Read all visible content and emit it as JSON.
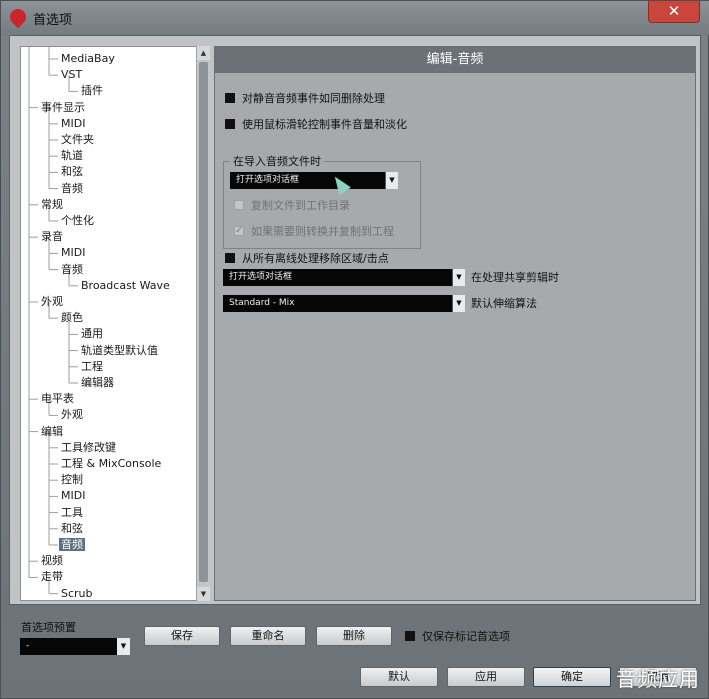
{
  "window": {
    "title": "首选项",
    "close_glyph": "✕"
  },
  "tree": {
    "items": [
      {
        "label": "MediaBay",
        "level": 1
      },
      {
        "label": "VST",
        "level": 1
      },
      {
        "label": "插件",
        "level": 2
      },
      {
        "label": "事件显示",
        "level": 0
      },
      {
        "label": "MIDI",
        "level": 1
      },
      {
        "label": "文件夹",
        "level": 1
      },
      {
        "label": "轨道",
        "level": 1
      },
      {
        "label": "和弦",
        "level": 1
      },
      {
        "label": "音频",
        "level": 1
      },
      {
        "label": "常规",
        "level": 0
      },
      {
        "label": "个性化",
        "level": 1
      },
      {
        "label": "录音",
        "level": 0
      },
      {
        "label": "MIDI",
        "level": 1
      },
      {
        "label": "音频",
        "level": 1
      },
      {
        "label": "Broadcast Wave",
        "level": 2
      },
      {
        "label": "外观",
        "level": 0
      },
      {
        "label": "颜色",
        "level": 1
      },
      {
        "label": "通用",
        "level": 2
      },
      {
        "label": "轨道类型默认值",
        "level": 2
      },
      {
        "label": "工程",
        "level": 2
      },
      {
        "label": "编辑器",
        "level": 2
      },
      {
        "label": "电平表",
        "level": 0
      },
      {
        "label": "外观",
        "level": 1
      },
      {
        "label": "编辑",
        "level": 0
      },
      {
        "label": "工具修改键",
        "level": 1
      },
      {
        "label": "工程 & MixConsole",
        "level": 1
      },
      {
        "label": "控制",
        "level": 1
      },
      {
        "label": "MIDI",
        "level": 1
      },
      {
        "label": "工具",
        "level": 1
      },
      {
        "label": "和弦",
        "level": 1
      },
      {
        "label": "音频",
        "level": 1,
        "selected": true
      },
      {
        "label": "视频",
        "level": 0
      },
      {
        "label": "走带",
        "level": 0
      },
      {
        "label": "Scrub",
        "level": 1
      }
    ]
  },
  "panel": {
    "header": "编辑-音频",
    "opt_mute_delete": {
      "label": "对静音音频事件如同删除处理",
      "checked": true
    },
    "opt_mouse_wheel": {
      "label": "使用鼠标滑轮控制事件音量和淡化",
      "checked": true
    },
    "import_group": {
      "title": "在导入音频文件时",
      "dropdown_value": "打开选项对话框",
      "copy_to_work": {
        "label": "复制文件到工作目录",
        "enabled": false,
        "checked": false
      },
      "convert_copy": {
        "label": "如果需要则转换并复制到工程",
        "enabled": false,
        "checked": true
      }
    },
    "opt_remove_regions": {
      "label": "从所有离线处理移除区域/击点",
      "checked": true
    },
    "shared_clips": {
      "value": "打开选项对话框",
      "label": "在处理共享剪辑时"
    },
    "time_stretch": {
      "value": "Standard - Mix",
      "label": "默认伸缩算法"
    }
  },
  "footer": {
    "preset_label": "首选项预置",
    "preset_value": "-",
    "save_label": "保存",
    "rename_label": "重命名",
    "delete_label": "删除",
    "only_marked_label": "仅保存标记首选项",
    "default_label": "默认",
    "apply_label": "应用",
    "ok_label": "确定",
    "cancel_label": "取消"
  },
  "watermark": "音频应用",
  "icons": {
    "app": "cubase-icon",
    "close": "close-icon",
    "dropdown": "chevron-down-icon",
    "cursor": "mouse-cursor-icon"
  }
}
